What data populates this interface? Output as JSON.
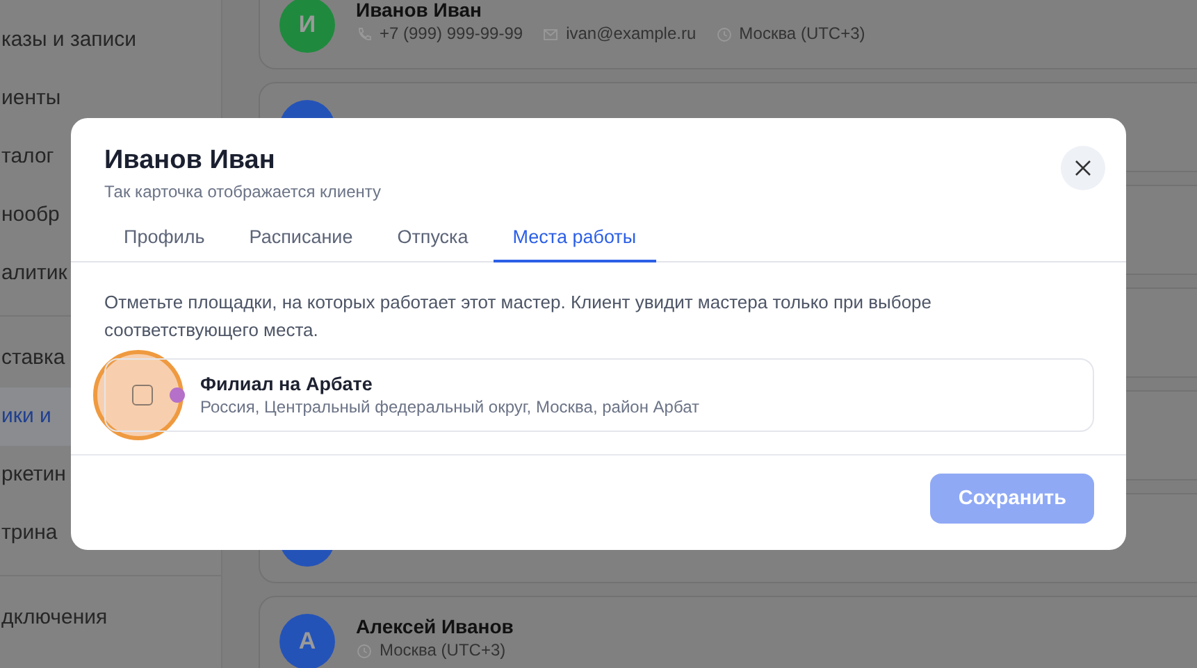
{
  "sidebar": {
    "items": [
      {
        "label": "казы и записи",
        "selected": false
      },
      {
        "label": "иенты",
        "selected": false
      },
      {
        "label": "талог",
        "selected": false
      },
      {
        "label": "нообр",
        "selected": false
      },
      {
        "label": "алитик",
        "selected": false
      },
      {
        "kind": "divider"
      },
      {
        "label": "ставка",
        "selected": false
      },
      {
        "label": "ики и",
        "selected": true
      },
      {
        "label": "ркетин",
        "selected": false
      },
      {
        "label": "трина",
        "selected": false
      },
      {
        "kind": "divider"
      },
      {
        "label": "дключения",
        "selected": false
      }
    ]
  },
  "contacts": [
    {
      "initial": "И",
      "color": "#1f8a3e",
      "name": "Иванов Иван",
      "phone": "+7 (999) 999-99-99",
      "email": "ivan@example.ru",
      "timezone": "Москва (UTC+3)"
    },
    {
      "color": "#2453b8"
    },
    {
      "color": "#2453b8"
    },
    {
      "initial": "А",
      "color": "#2453b8",
      "name": "Алексей Иванов",
      "timezone": "Москва (UTC+3)"
    }
  ],
  "dialog": {
    "title": "Иванов Иван",
    "subtitle": "Так карточка отображается клиенту",
    "tabs": [
      {
        "label": "Профиль",
        "selected": false
      },
      {
        "label": "Расписание",
        "selected": false
      },
      {
        "label": "Отпуска",
        "selected": false
      },
      {
        "label": "Места работы",
        "selected": true
      }
    ],
    "description": "Отметьте площадки, на которых работает этот мастер. Клиент увидит мастера только при выборе соответствующего места.",
    "locations": [
      {
        "name": "Филиал на Арбате",
        "address": "Россия, Центральный федеральный округ, Москва, район Арбат",
        "checked": false,
        "highlighted": true,
        "color": "#b570c9"
      }
    ],
    "save_button": {
      "label": "Сохранить",
      "disabled": true
    }
  }
}
